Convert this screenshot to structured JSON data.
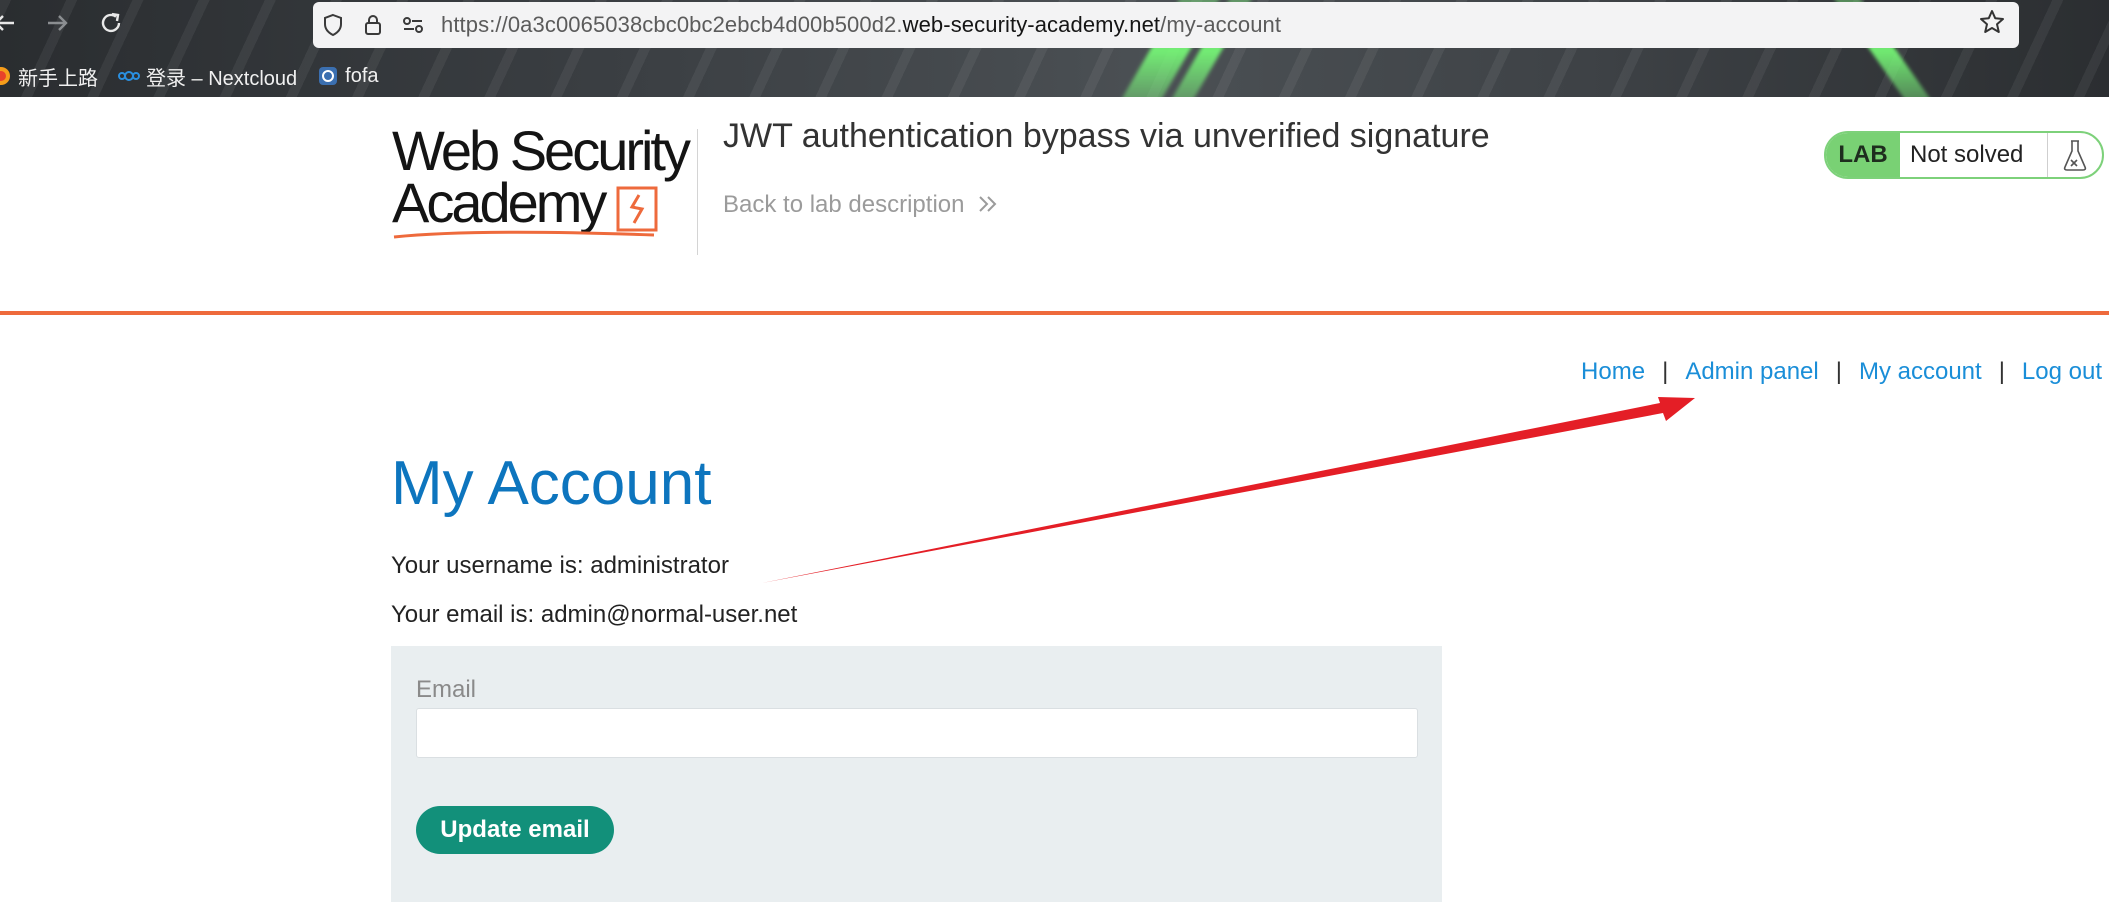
{
  "browser": {
    "back_icon": "arrow-left-icon",
    "forward_icon": "arrow-right-icon",
    "reload_icon": "reload-icon",
    "url_prefix": "https://0a3c0065038cbc0bc2ebcb4d00b500d2.",
    "url_domain": "web-security-academy.net",
    "url_path": "/my-account",
    "bookmarks": [
      {
        "label": "新手上路",
        "icon": "firefox-icon"
      },
      {
        "label": "登录 – Nextcloud",
        "icon": "nextcloud-icon"
      },
      {
        "label": "fofa",
        "icon": "fofa-icon"
      }
    ]
  },
  "lab": {
    "logo_line1": "Web Security",
    "logo_line2": "Academy",
    "title": "JWT authentication bypass via unverified signature",
    "back_link": "Back to lab description",
    "badge_tag": "LAB",
    "badge_status": "Not solved"
  },
  "nav": {
    "home": "Home",
    "admin_panel": "Admin panel",
    "my_account": "My account",
    "log_out": "Log out",
    "separator": "|"
  },
  "main": {
    "title": "My Account",
    "username_line": "Your username is: administrator",
    "email_line": "Your email is: admin@normal-user.net",
    "form": {
      "email_label": "Email",
      "email_value": "",
      "submit_label": "Update email"
    }
  },
  "colors": {
    "accent_orange": "#ee6a3c",
    "link_blue": "#1a8ed8",
    "title_blue": "#0d75be",
    "button_green": "#12907a",
    "lab_green": "#79d174",
    "annotation_red": "#e41e26"
  }
}
